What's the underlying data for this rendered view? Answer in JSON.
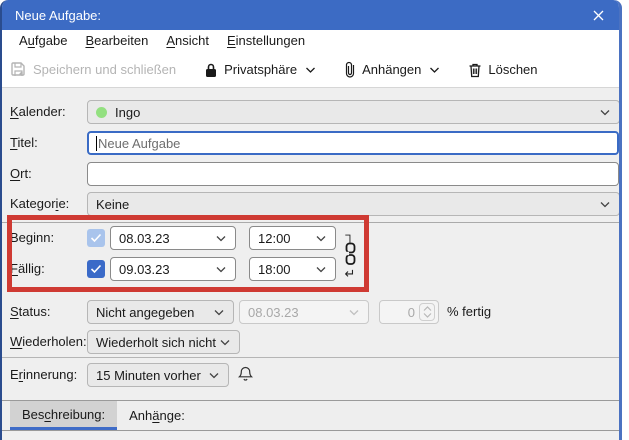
{
  "window": {
    "title": "Neue Aufgabe:"
  },
  "menubar": {
    "items": [
      {
        "pre": "A",
        "key": "u",
        "post": "fgabe"
      },
      {
        "pre": "",
        "key": "B",
        "post": "earbeiten"
      },
      {
        "pre": "",
        "key": "A",
        "post": "nsicht"
      },
      {
        "pre": "",
        "key": "E",
        "post": "instellungen"
      }
    ]
  },
  "toolbar": {
    "save_label": "Speichern und schließen",
    "privacy_label": "Privatsphäre",
    "attach_label": "Anhängen",
    "delete_label": "Löschen"
  },
  "form": {
    "kalender": {
      "label": {
        "pre": "",
        "key": "K",
        "post": "alender:"
      },
      "value": "Ingo"
    },
    "titel": {
      "label": {
        "pre": "",
        "key": "T",
        "post": "itel:"
      },
      "value": "Neue Aufgabe"
    },
    "ort": {
      "label": {
        "pre": "",
        "key": "O",
        "post": "rt:"
      },
      "value": ""
    },
    "kategorie": {
      "label": {
        "pre": "Kategor",
        "key": "i",
        "post": "e:"
      },
      "value": "Keine"
    },
    "beginn": {
      "label": {
        "pre": "Beginn:",
        "key": "",
        "post": ""
      },
      "date": "08.03.23",
      "time": "12:00"
    },
    "faellig": {
      "label": {
        "pre": "",
        "key": "F",
        "post": "ällig:"
      },
      "date": "09.03.23",
      "time": "18:00"
    },
    "status": {
      "label": {
        "pre": "",
        "key": "S",
        "post": "tatus:"
      },
      "value": "Nicht angegeben",
      "date": "08.03.23",
      "percent": "0",
      "percent_suffix": "% fertig"
    },
    "wiederholen": {
      "label": {
        "pre": "",
        "key": "W",
        "post": "iederholen:"
      },
      "value": "Wiederholt sich nicht"
    },
    "erinnerung": {
      "label": {
        "pre": "E",
        "key": "r",
        "post": "innerung:"
      },
      "value": "15 Minuten vorher"
    }
  },
  "tabs": {
    "beschreibung": {
      "pre": "Bes",
      "key": "c",
      "post": "hreibung:"
    },
    "anhaenge": {
      "pre": "Anh",
      "key": "ä",
      "post": "nge:"
    }
  },
  "glyphs": {
    "corner": "┐",
    "return": "↵"
  },
  "colors": {
    "titlebar_blue": "#3c6bc4",
    "annotation_red": "#cf3a33",
    "checkbox_blue": "#3a6ac8",
    "checkbox_disabled_blue": "#a9c4ec",
    "calendar_dot_green": "#93e080",
    "focus_border_blue": "#3a6bc5",
    "active_tab_underline": "#3f6cc7"
  }
}
